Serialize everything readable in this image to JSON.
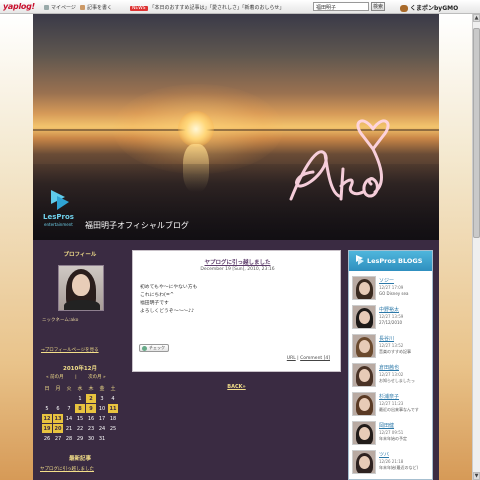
{
  "toolbar": {
    "logo": "yaplog!",
    "items": [
      "マイページ",
      "記事を書く"
    ],
    "news_badge": "NEWS",
    "news_text": "「本日のおすすめ記事は」「愛されしさ」「新着のおしらせ」",
    "search_placeholder": "福田明子",
    "search_button": "検索",
    "kuma": "くまポンbyGMO"
  },
  "header": {
    "blog_title": "福田明子オフィシャルブログ",
    "logo_text": "LesPros",
    "logo_sub": "entertainment",
    "signature": "Ako"
  },
  "sidebar": {
    "profile_heading": "プロフィール",
    "nickname": "ニックネーム:ako",
    "profile_link": "→プロフィールページを見る",
    "calendar": {
      "title": "2010年12月",
      "prev": "« 前の月",
      "sep": "|",
      "next": "次の月 »",
      "weekdays": [
        "日",
        "月",
        "火",
        "水",
        "木",
        "金",
        "土"
      ],
      "weeks": [
        [
          "",
          "",
          "",
          "1",
          "2",
          "3",
          "4"
        ],
        [
          "5",
          "6",
          "7",
          "8",
          "9",
          "10",
          "11"
        ],
        [
          "12",
          "13",
          "14",
          "15",
          "16",
          "17",
          "18"
        ],
        [
          "19",
          "20",
          "21",
          "22",
          "23",
          "24",
          "25"
        ],
        [
          "26",
          "27",
          "28",
          "29",
          "30",
          "31",
          ""
        ]
      ],
      "marked": [
        "2",
        "8",
        "9",
        "11",
        "12",
        "13",
        "19",
        "20"
      ]
    },
    "recent_heading": "最新記事",
    "recent_items": [
      "ヤプログに引っ越しました"
    ]
  },
  "entry": {
    "title": "ヤプログに引っ越しました",
    "date": "December 19 [Sun], 2010, 23:16",
    "body": [
      "初めてもや〜にやない方も",
      "これにちわ(=^",
      "福田明子です",
      "よろしくどうぞ〜〜〜♪♪"
    ],
    "check_button": "チェック",
    "url_label": "URL",
    "separator": "|",
    "comment_label": "Comment [4]",
    "back": "BACK»"
  },
  "blogs_panel": {
    "title": "LesPros BLOGS",
    "bloggers": [
      {
        "name": "ソジー",
        "time": "12/27 17:09",
        "post": "GO Disney sea",
        "hair": "#3a2a20"
      },
      {
        "name": "中野裕太",
        "time": "12/27 13:59",
        "post": "27/12/2010",
        "hair": "#1e1a18"
      },
      {
        "name": "長谷川",
        "time": "12/27 13:52",
        "post": "音楽のすすめ記事",
        "hair": "#6b4a2e"
      },
      {
        "name": "倉田茜也",
        "time": "12/27 13:02",
        "post": "お知らせしましたっ",
        "hair": "#4a3326"
      },
      {
        "name": "杉浦奈子",
        "time": "12/27 11:23",
        "post": "最近の出来事なんです",
        "hair": "#5a3a24"
      },
      {
        "name": "岡田健",
        "time": "12/27 09:51",
        "post": "年末年始の予定",
        "hair": "#221c1a"
      },
      {
        "name": "ツバ",
        "time": "12/26 21:18",
        "post": "年末年始(最近のなど)",
        "hair": "#2e2220"
      }
    ]
  }
}
